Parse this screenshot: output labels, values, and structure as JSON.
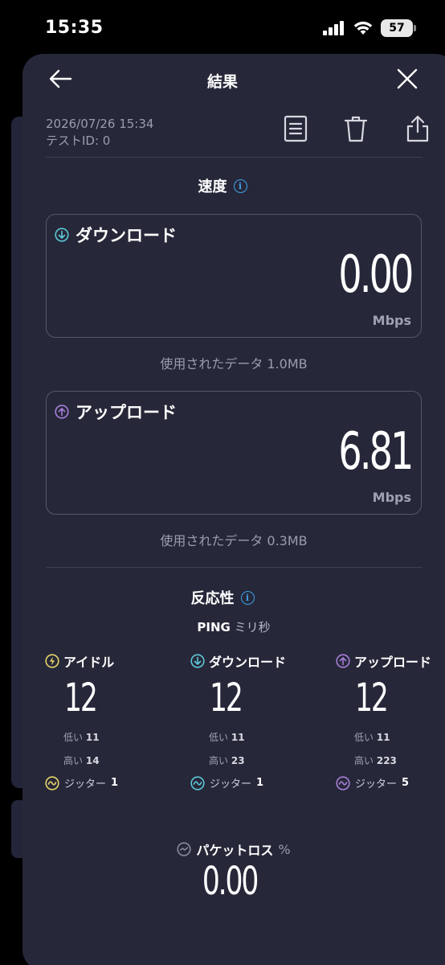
{
  "status": {
    "time": "15:35",
    "battery": "57"
  },
  "header": {
    "title": "結果"
  },
  "meta": {
    "date": "2026/07/26 15:34",
    "test_id": "テストID: 0"
  },
  "speed": {
    "title": "速度",
    "download": {
      "label": "ダウンロード",
      "value": "0.00",
      "unit": "Mbps",
      "data_used": "使用されたデータ 1.0MB"
    },
    "upload": {
      "label": "アップロード",
      "value": "6.81",
      "unit": "Mbps",
      "data_used": "使用されたデータ 0.3MB"
    }
  },
  "responsiveness": {
    "title": "反応性",
    "ping_label": "PING",
    "ping_unit": "ミリ秒",
    "low_label": "低い",
    "high_label": "高い",
    "jitter_label": "ジッター",
    "columns": [
      {
        "label": "アイドル",
        "value": "12",
        "low": "11",
        "high": "14",
        "jitter": "1"
      },
      {
        "label": "ダウンロード",
        "value": "12",
        "low": "11",
        "high": "23",
        "jitter": "1"
      },
      {
        "label": "アップロード",
        "value": "12",
        "low": "11",
        "high": "223",
        "jitter": "5"
      }
    ]
  },
  "packet_loss": {
    "label": "パケットロス",
    "unit": "%",
    "value": "0.00"
  },
  "colors": {
    "background": "#262839",
    "download": "#5ec8d8",
    "upload": "#a97fd9",
    "idle": "#e8d56a",
    "info": "#3d9fe6"
  }
}
